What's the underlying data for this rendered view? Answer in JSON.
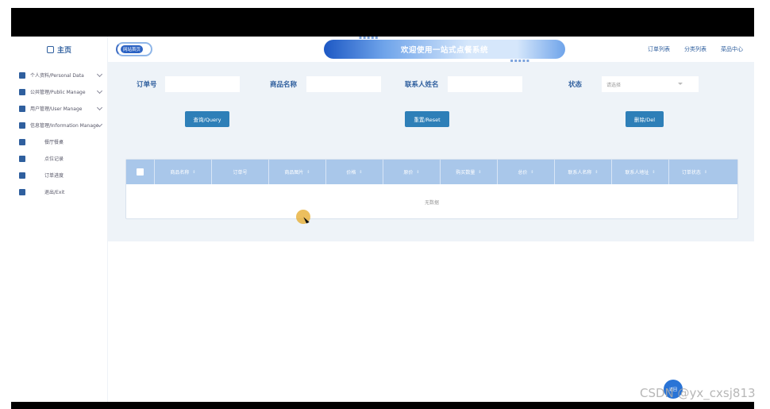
{
  "sidebar": {
    "home_label": "主页",
    "items": [
      {
        "label": "个人资料/Personal Data",
        "has_children": true
      },
      {
        "label": "公共管理/Public Manage",
        "has_children": true
      },
      {
        "label": "用户管理/User Manage",
        "has_children": true
      },
      {
        "label": "信息管理/Information Manage",
        "has_children": true
      },
      {
        "label": "餐厅餐桌",
        "has_children": false
      },
      {
        "label": "点位记录",
        "has_children": false
      },
      {
        "label": "订单进度",
        "has_children": false
      },
      {
        "label": "退出/Exit",
        "has_children": false
      }
    ]
  },
  "header": {
    "logo_text": "网站首页",
    "title": "欢迎使用一站式点餐系统",
    "nav": [
      "订单列表",
      "分类列表",
      "菜品中心"
    ]
  },
  "search": {
    "order_no_label": "订单号",
    "product_name_label": "商品名称",
    "contact_name_label": "联系人姓名",
    "status_label": "状态",
    "status_placeholder": "请选择"
  },
  "buttons": {
    "query": "查询/Query",
    "reset": "重置/Reset",
    "delete": "删除/Del"
  },
  "table": {
    "columns": [
      "商品名称",
      "订单号",
      "商品图片",
      "价格",
      "原价",
      "购买数量",
      "总价",
      "联系人名称",
      "联系人地址",
      "订单状态"
    ],
    "empty_text": "无数据"
  },
  "float_button_label": "返回",
  "watermark": "CSDN @yx_cxsj813",
  "colors": {
    "accent": "#2f5f9e",
    "button": "#2e7fb8",
    "table_header": "#a9c7ea",
    "panel_bg": "#eef3f8"
  }
}
